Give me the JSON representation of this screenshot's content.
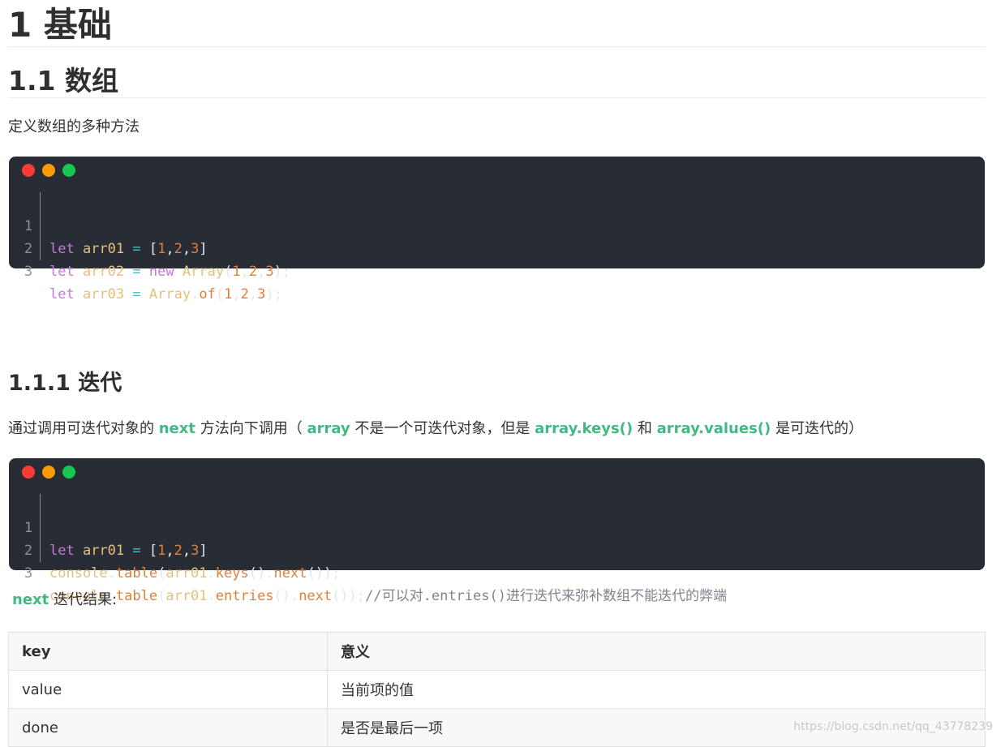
{
  "headings": {
    "h1": "1 基础",
    "h2": "1.1 数组",
    "h3": "1.1.1 迭代"
  },
  "intro_text": "定义数组的多种方法",
  "code_block_1": {
    "line_numbers": [
      "1",
      "2",
      "3"
    ],
    "lines": [
      "let arr01 = [1,2,3]",
      "let arr02 = new Array(1,2,3);",
      "let arr03 = Array.of(1,2,3);"
    ]
  },
  "iteration_text": {
    "part1": "通过调用可迭代对象的 ",
    "hl1": "next",
    "part2": " 方法向下调用（ ",
    "hl2": "array",
    "part3": " 不是一个可迭代对象，但是 ",
    "hl3": "array.keys()",
    "part4": " 和 ",
    "hl4": "array.values()",
    "part5": " 是可迭代的）"
  },
  "code_block_2": {
    "line_numbers": [
      "1",
      "2",
      "3"
    ],
    "lines": [
      "let arr01 = [1,2,3]",
      "console.table(arr01.keys().next());",
      "console.table(arr01.entries().next());//可以对.entries()进行迭代来弥补数组不能迭代的弊端"
    ]
  },
  "result_text": {
    "hl": "next",
    "rest": " 迭代结果:"
  },
  "table": {
    "headers": [
      "key",
      "意义"
    ],
    "rows": [
      [
        "value",
        "当前项的值"
      ],
      [
        "done",
        "是否是最后一项"
      ]
    ]
  },
  "watermark": "https://blog.csdn.net/qq_43778239",
  "colors": {
    "highlight": "#42b983",
    "code_background": "#282c34",
    "dot_red": "#fc3b34",
    "dot_orange": "#fd9b07",
    "dot_green": "#17c653"
  }
}
